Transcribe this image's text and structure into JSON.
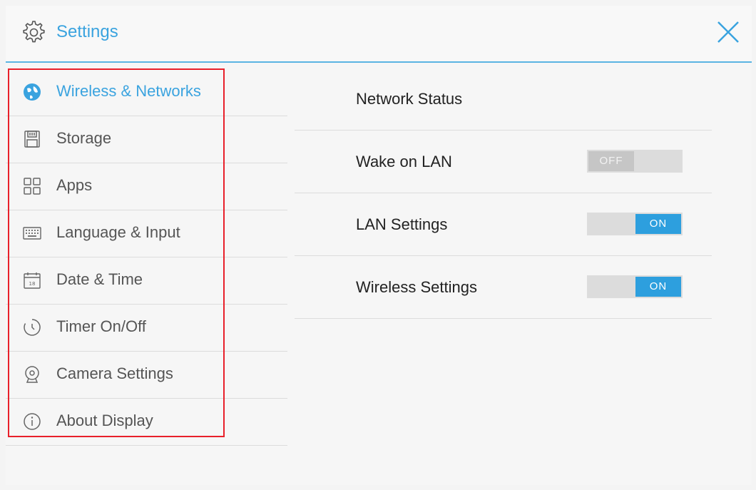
{
  "header": {
    "title": "Settings",
    "icon": "gear-icon",
    "close_icon": "close-icon"
  },
  "sidebar": {
    "items": [
      {
        "label": "Wireless & Networks",
        "icon": "globe-icon",
        "active": true
      },
      {
        "label": "Storage",
        "icon": "storage-icon",
        "active": false
      },
      {
        "label": "Apps",
        "icon": "apps-grid-icon",
        "active": false
      },
      {
        "label": "Language & Input",
        "icon": "keyboard-icon",
        "active": false
      },
      {
        "label": "Date & Time",
        "icon": "calendar-icon",
        "active": false
      },
      {
        "label": "Timer On/Off",
        "icon": "timer-icon",
        "active": false
      },
      {
        "label": "Camera Settings",
        "icon": "camera-icon",
        "active": false
      },
      {
        "label": "About Display",
        "icon": "info-icon",
        "active": false
      }
    ]
  },
  "main": {
    "rows": [
      {
        "label": "Network Status"
      },
      {
        "label": "Wake on LAN",
        "toggle": "OFF"
      },
      {
        "label": "LAN Settings",
        "toggle": "ON"
      },
      {
        "label": "Wireless Settings",
        "toggle": "ON"
      }
    ]
  },
  "colors": {
    "accent": "#3aa3df",
    "toggle_on": "#2d9fde",
    "highlight_box": "#e8202a"
  }
}
